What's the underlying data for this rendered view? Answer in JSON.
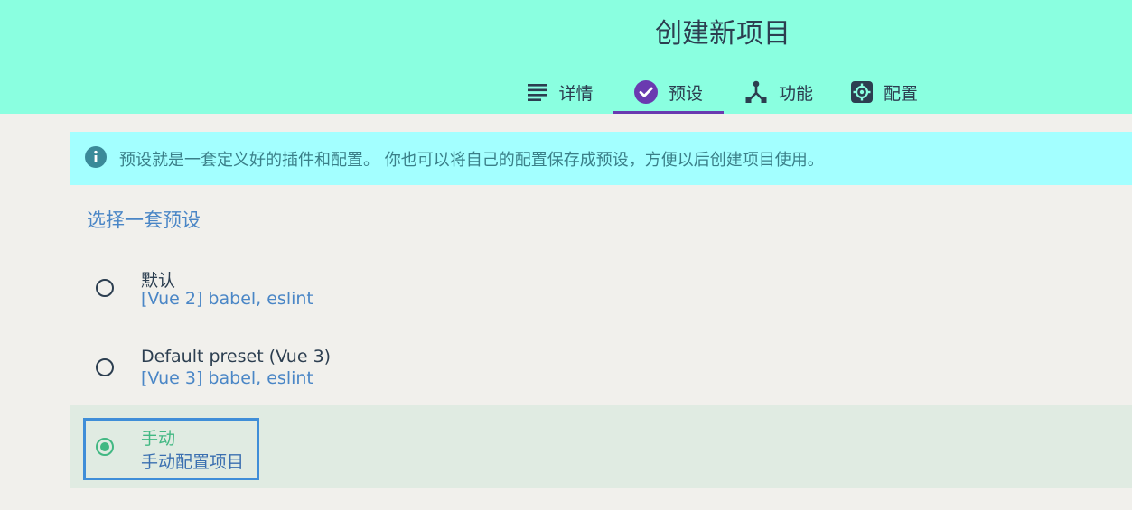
{
  "header": {
    "title": "创建新项目",
    "tabs": [
      {
        "label": "详情",
        "icon": "list-icon"
      },
      {
        "label": "预设",
        "icon": "check-circle-icon",
        "active": true
      },
      {
        "label": "功能",
        "icon": "fork-icon"
      },
      {
        "label": "配置",
        "icon": "gear-icon"
      }
    ]
  },
  "info": {
    "icon": "info-icon",
    "text": "预设就是一套定义好的插件和配置。 你也可以将自己的配置保存成预设，方便以后创建项目使用。"
  },
  "presets_section": {
    "title": "选择一套预设",
    "items": [
      {
        "name": "默认",
        "description": "[Vue 2] babel, eslint",
        "selected": false
      },
      {
        "name": "Default preset (Vue 3)",
        "description": "[Vue 3] babel, eslint",
        "selected": false
      },
      {
        "name": "手动",
        "description": "手动配置项目",
        "selected": true
      }
    ]
  },
  "colors": {
    "header_bg": "#8affe0",
    "active_tab_underline": "#6a3ab0",
    "info_bg": "#a3ffff",
    "accent_green": "#42b883",
    "link_blue": "#4a86c6"
  }
}
